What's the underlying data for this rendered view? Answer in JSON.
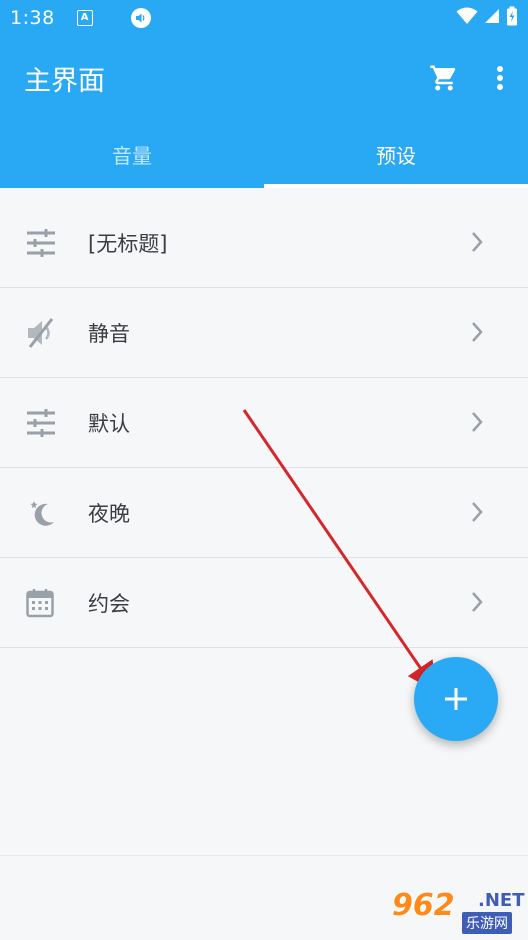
{
  "status_bar": {
    "time": "1:38",
    "a_badge": "A",
    "icons": [
      "a-notification-icon",
      "volume-notification-icon",
      "wifi-icon",
      "signal-icon",
      "battery-icon"
    ]
  },
  "app_bar": {
    "title": "主界面",
    "icons": [
      "cart-icon",
      "more-vert-icon"
    ]
  },
  "tabs": [
    {
      "label": "音量",
      "active": false
    },
    {
      "label": "预设",
      "active": true
    }
  ],
  "presets": [
    {
      "label": "[无标题]",
      "icon": "sliders-icon"
    },
    {
      "label": "静音",
      "icon": "mute-icon"
    },
    {
      "label": "默认",
      "icon": "sliders-icon"
    },
    {
      "label": "夜晚",
      "icon": "moon-icon"
    },
    {
      "label": "约会",
      "icon": "calendar-icon"
    }
  ],
  "fab": {
    "icon": "plus-icon"
  },
  "watermark": {
    "main": "962",
    "suffix": ".NET",
    "sub": "乐游网"
  },
  "colors": {
    "primary": "#29a8f3",
    "fab": "#2aaaf5",
    "background": "#f6f7f9",
    "text": "#3a3d42",
    "icon": "#9aa0a8",
    "annotation_arrow": "#d6262a"
  }
}
